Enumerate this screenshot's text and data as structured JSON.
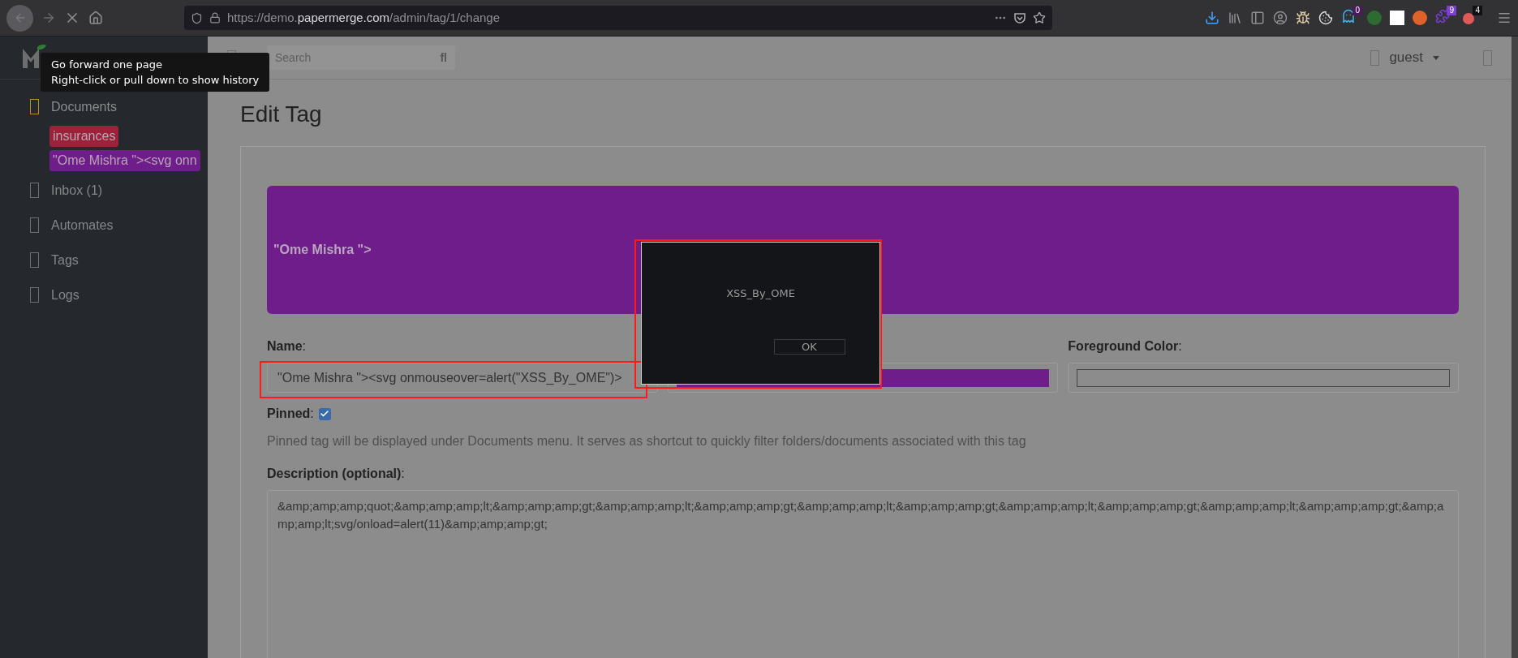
{
  "browser": {
    "url_scheme": "https://demo.",
    "url_domain": "papermerge.com",
    "url_path": "/admin/tag/1/change",
    "extension_badges": [
      {
        "text": "0",
        "color": "#4a1a5c"
      },
      {
        "text": "9",
        "color": "#7b3fd6"
      },
      {
        "text": "4",
        "color": "#111111"
      }
    ]
  },
  "tooltip": {
    "lines": [
      "Go forward one page",
      "Right-click or pull down to show history"
    ]
  },
  "sidebar": {
    "items": [
      {
        "kind": "nav",
        "label": "Documents",
        "selected": true
      },
      {
        "kind": "tag",
        "label": "insurances",
        "color": "#9b2238"
      },
      {
        "kind": "tag",
        "label": "\"Ome Mishra \"><svg onn",
        "color": "#6f1d8b"
      },
      {
        "kind": "nav",
        "label": "Inbox (1)",
        "selected": false
      },
      {
        "kind": "nav",
        "label": "Automates",
        "selected": false
      },
      {
        "kind": "nav",
        "label": "Tags",
        "selected": false
      },
      {
        "kind": "nav",
        "label": "Logs",
        "selected": false
      }
    ]
  },
  "topbar": {
    "search": {
      "placeholder": "Search",
      "button": "fl"
    },
    "user": "guest"
  },
  "page": {
    "title": "Edit Tag",
    "banner": {
      "text": "\"Ome Mishra \">",
      "color": "#6f1d8b"
    },
    "name": {
      "label": "**Name**:",
      "value": "\"Ome Mishra \"><svg onmouseover=alert(\"XSS_By_OME\")>"
    },
    "background_color": {
      "color": "#6f1d8b"
    },
    "foreground_color": {
      "label": "**Foreground Color**:"
    },
    "pinned": {
      "label": "**Pinned**:",
      "checked": true
    },
    "pinned_help": "Pinned tag will be displayed under Documents menu. It serves as shortcut to quickly filter folders/documents associated with this tag",
    "description": {
      "label": "**Description (optional)**:",
      "value": "&amp;amp;amp;quot;&amp;amp;amp;lt;&amp;amp;amp;gt;&amp;amp;amp;lt;&amp;amp;amp;gt;&amp;amp;amp;lt;&amp;amp;amp;gt;&amp;amp;amp;lt;&amp;amp;amp;gt;&amp;amp;amp;lt;&amp;amp;amp;gt;&amp;amp;amp;lt;svg/onload=alert(11)&amp;amp;amp;gt;"
    }
  },
  "dialog": {
    "message": "XSS_By_OME",
    "button": "OK"
  }
}
